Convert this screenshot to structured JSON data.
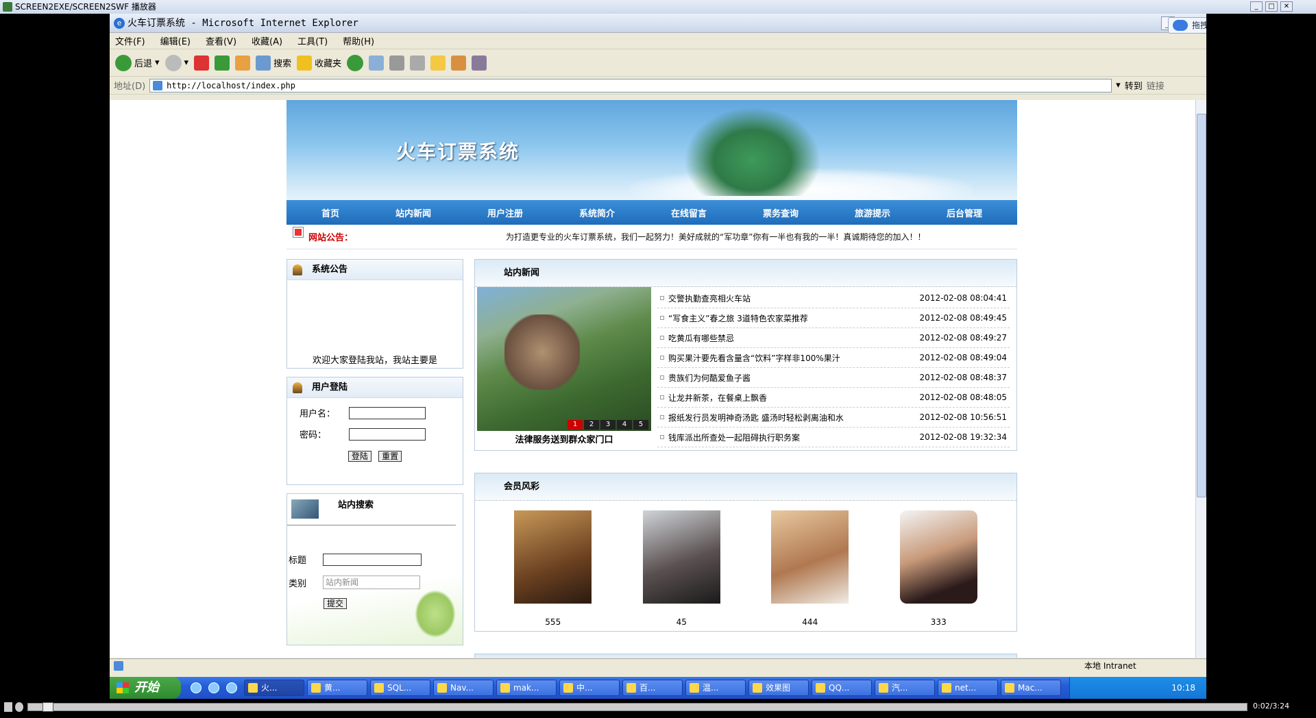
{
  "player": {
    "title": "SCREEN2EXE/SCREEN2SWF 播放器",
    "time": "0:02/3:24"
  },
  "ie": {
    "title": "火车订票系统 - Microsoft Internet Explorer",
    "upload": "拖拽上传",
    "menu": [
      "文件(F)",
      "编辑(E)",
      "查看(V)",
      "收藏(A)",
      "工具(T)",
      "帮助(H)"
    ],
    "toolbar": {
      "back": "后退",
      "search": "搜索",
      "favorites": "收藏夹"
    },
    "address_label": "地址(D)",
    "address": "http://localhost/index.php",
    "go": "转到",
    "links": "链接",
    "status_zone": "本地 Intranet"
  },
  "site": {
    "banner_title": "火车订票系统",
    "nav": [
      "首页",
      "站内新闻",
      "用户注册",
      "系统简介",
      "在线留言",
      "票务查询",
      "旅游提示",
      "后台管理"
    ],
    "notice_label": "网站公告：",
    "notice_text": "为打造更专业的火车订票系统，我们一起努力！美好成就的“军功章”你有一半也有我的一半！真诚期待您的加入！！",
    "sysnotice": {
      "title": "系统公告",
      "text": "欢迎大家登陆我站，我站主要是"
    },
    "login": {
      "title": "用户登陆",
      "user_label": "用户名：",
      "pass_label": "密码：",
      "login_btn": "登陆",
      "reset_btn": "重置"
    },
    "search": {
      "title": "站内搜索",
      "title_label": "标题",
      "category_label": "类别",
      "category_value": "站内新闻",
      "submit": "提交"
    },
    "news": {
      "title": "站内新闻",
      "caption": "法律服务送到群众家门口",
      "pager": [
        "1",
        "2",
        "3",
        "4",
        "5"
      ],
      "items": [
        {
          "t": "交警执勤查亮相火车站",
          "d": "2012-02-08 08:04:41"
        },
        {
          "t": "“写食主义”春之旅 3道特色农家菜推荐",
          "d": "2012-02-08 08:49:45"
        },
        {
          "t": "吃黄瓜有哪些禁忌",
          "d": "2012-02-08 08:49:27"
        },
        {
          "t": "购买果汁要先看含量含“饮料”字样非100%果汁",
          "d": "2012-02-08 08:49:04"
        },
        {
          "t": "贵族们为何酷爱鱼子酱",
          "d": "2012-02-08 08:48:37"
        },
        {
          "t": "让龙井新茶，在餐桌上飘香",
          "d": "2012-02-08 08:48:05"
        },
        {
          "t": "报纸发行员发明神奇汤匙 盛汤时轻松剥离油和水",
          "d": "2012-02-08 10:56:51"
        },
        {
          "t": "钱库派出所查处一起阻碍执行职务案",
          "d": "2012-02-08 19:32:34"
        }
      ]
    },
    "members": {
      "title": "会员风彩",
      "list": [
        "555",
        "45",
        "444",
        "333"
      ]
    }
  },
  "taskbar": {
    "start": "开始",
    "tasks": [
      "火...",
      "黄...",
      "SQL...",
      "Nav...",
      "mak...",
      "中...",
      "百...",
      "温...",
      "效果图",
      "QQ...",
      "汽...",
      "net...",
      "Mac..."
    ],
    "clock": "10:18"
  }
}
